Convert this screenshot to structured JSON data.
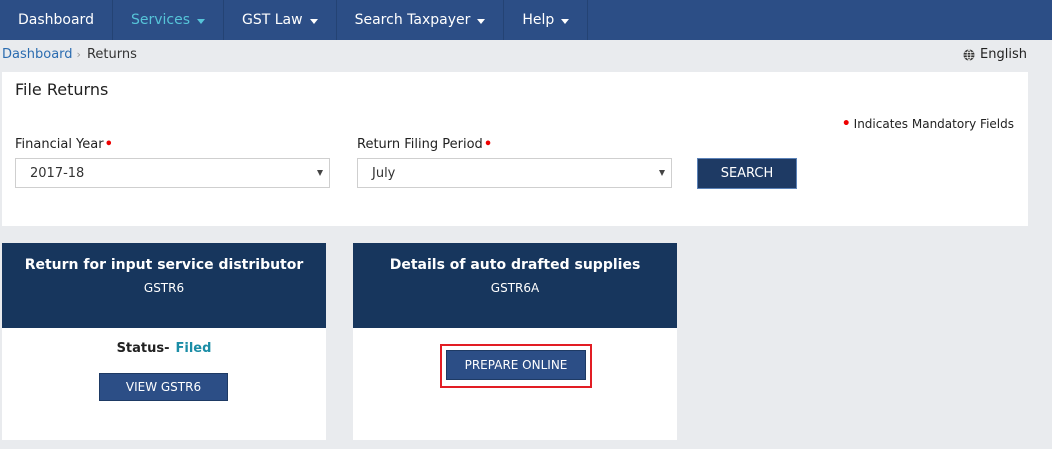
{
  "nav": {
    "items": [
      {
        "label": "Dashboard",
        "caret": false
      },
      {
        "label": "Services",
        "caret": true,
        "active": true
      },
      {
        "label": "GST Law",
        "caret": true
      },
      {
        "label": "Search Taxpayer",
        "caret": true
      },
      {
        "label": "Help",
        "caret": true
      }
    ]
  },
  "breadcrumb": {
    "home": "Dashboard",
    "current": "Returns"
  },
  "language": {
    "label": "English"
  },
  "file_returns": {
    "title": "File Returns",
    "mandatory_note": "Indicates Mandatory Fields",
    "financial_year": {
      "label": "Financial Year",
      "value": "2017-18"
    },
    "filing_period": {
      "label": "Return Filing Period",
      "value": "July"
    },
    "search_label": "SEARCH"
  },
  "cards": [
    {
      "title": "Return for input service distributor",
      "subtitle": "GSTR6",
      "status_label": "Status-",
      "status_value": "Filed",
      "button_label": "VIEW GSTR6"
    },
    {
      "title": "Details of auto drafted supplies",
      "subtitle": "GSTR6A",
      "button_label": "PREPARE ONLINE"
    }
  ],
  "colors": {
    "navbar": "#2c4e86",
    "card_header": "#17365d",
    "active_nav": "#56c4d8",
    "status_filed": "#1b8da6",
    "highlight": "#e21d24"
  }
}
